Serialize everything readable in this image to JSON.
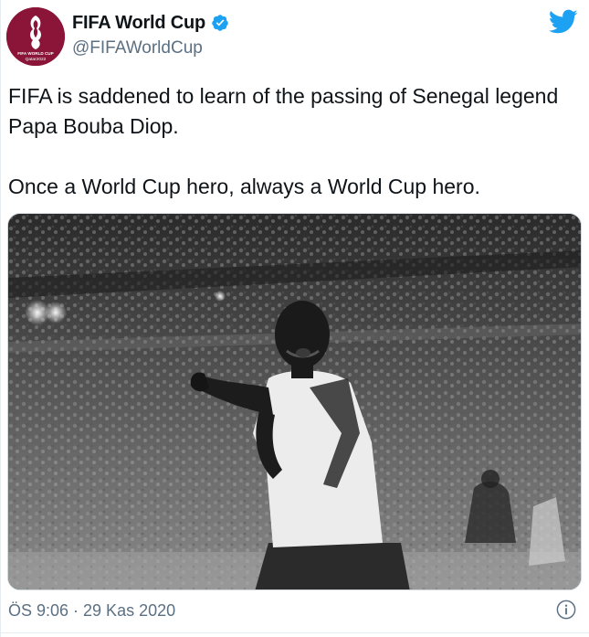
{
  "user": {
    "display_name": "FIFA World Cup",
    "handle": "@FIFAWorldCup",
    "verified": true,
    "avatar_icon": "fifa-world-cup-qatar-2022-logo",
    "avatar_text": "FIFA WORLD CUP Qatar2022",
    "avatar_color": "#8a1538"
  },
  "tweet": {
    "line1": "FIFA is saddened to learn of the passing of Senegal legend Papa Bouba Diop.",
    "line2": "Once a World Cup hero, always a World Cup hero.",
    "timestamp": "ÖS 9:06 · 29 Kas 2020"
  },
  "media": {
    "type": "photo",
    "style": "black-and-white"
  },
  "icons": {
    "brand": "twitter-bird-icon",
    "verified": "verified-badge-icon",
    "info": "info-icon"
  },
  "colors": {
    "twitter_blue": "#1da1f2",
    "text_primary": "#0f1419",
    "text_secondary": "#5b7083"
  }
}
